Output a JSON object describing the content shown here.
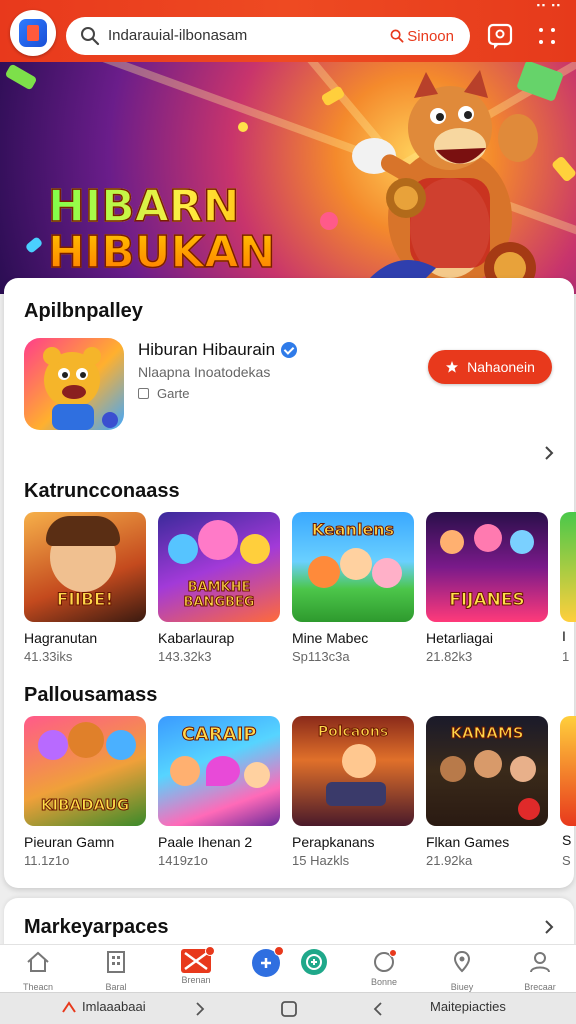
{
  "search": {
    "query": "Indarauial-ilbonasam",
    "button_label": "Sinoon"
  },
  "banner": {
    "title_line1": "HIBARN",
    "title_line2": "HIBUKAN"
  },
  "featured": {
    "section_title": "Apilbnpalley",
    "app_name": "Hiburan Hibaurain",
    "developer": "Nlaapna Inoatodekas",
    "category": "Garte",
    "install_label": "Nahaonein"
  },
  "section1": {
    "title": "Katruncconaass",
    "items": [
      {
        "name": "Hagranutan",
        "count": "41.33iks",
        "caption": "FIIBE!"
      },
      {
        "name": "Kabarlaurap",
        "count": "143.32k3",
        "caption": "BAMKHE BANGBEG"
      },
      {
        "name": "Mine Mabec",
        "count": "Sp113c3a",
        "caption": "Keanlens"
      },
      {
        "name": "Hetarliagai",
        "count": "21.82k3",
        "caption": "FIJANES"
      }
    ],
    "peek_name": "I",
    "peek_count": "1"
  },
  "section2": {
    "title": "Pallousamass",
    "items": [
      {
        "name": "Pieuran Gamn",
        "count": "11.1z1o",
        "caption": "KIBADAUG"
      },
      {
        "name": "Paale Ihenan 2",
        "count": "1419z1o",
        "caption": "CARAIP"
      },
      {
        "name": "Perapkanans",
        "count": "15 Hazkls",
        "caption": "Polcaons"
      },
      {
        "name": "Flkan Games",
        "count": "21.92ka",
        "caption": "KANAMS"
      }
    ],
    "peek_name": "S",
    "peek_count": "S"
  },
  "marketplace": {
    "title": "Markeyarpaces"
  },
  "bottom_nav": [
    {
      "label": "Theacn",
      "icon": "home-icon"
    },
    {
      "label": "Baral",
      "icon": "building-icon"
    },
    {
      "label": "Brenan",
      "icon": "mail-icon"
    },
    {
      "label": "",
      "icon": "apps-icon"
    },
    {
      "label": "",
      "icon": "games-icon"
    },
    {
      "label": "Bonne",
      "icon": "circle-icon"
    },
    {
      "label": "Biuey",
      "icon": "location-icon"
    },
    {
      "label": "Brecaar",
      "icon": "profile-icon"
    }
  ],
  "system_bar": {
    "left_label": "Imlaaabaai",
    "right_label": "Maitepiacties"
  },
  "colors": {
    "accent": "#e8391c",
    "verified": "#2f7be9"
  }
}
